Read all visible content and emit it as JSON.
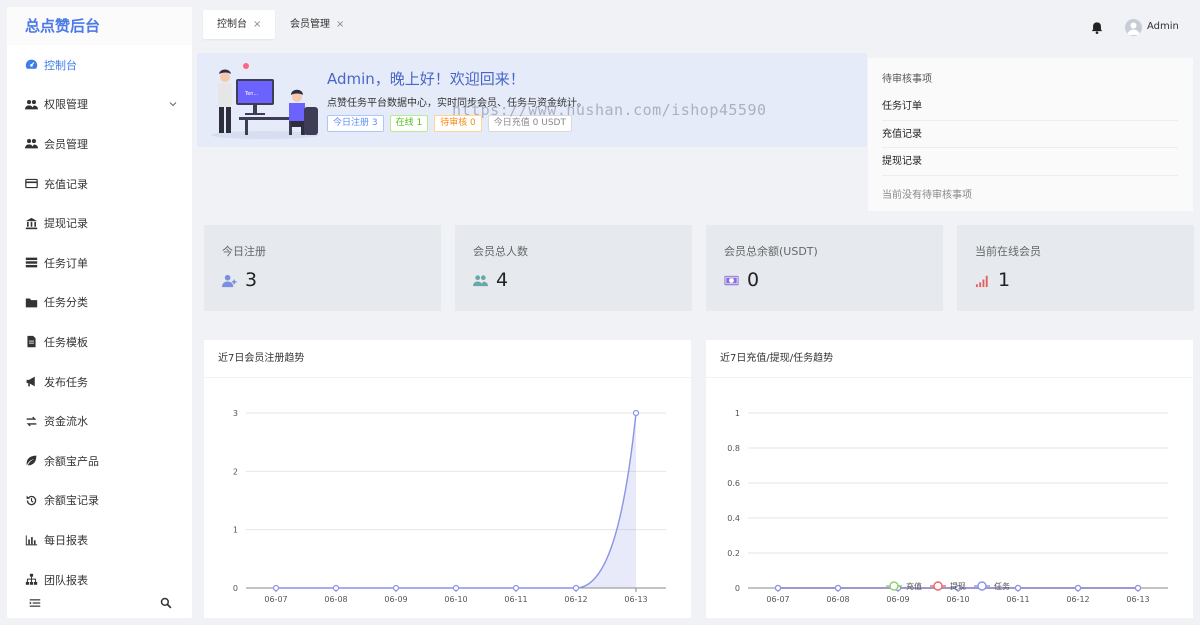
{
  "brand": "总点赞后台",
  "sidebar": {
    "items": [
      {
        "label": "控制台"
      },
      {
        "label": "权限管理"
      },
      {
        "label": "会员管理"
      },
      {
        "label": "充值记录"
      },
      {
        "label": "提现记录"
      },
      {
        "label": "任务订单"
      },
      {
        "label": "任务分类"
      },
      {
        "label": "任务模板"
      },
      {
        "label": "发布任务"
      },
      {
        "label": "资金流水"
      },
      {
        "label": "余额宝产品"
      },
      {
        "label": "余额宝记录"
      },
      {
        "label": "每日报表"
      },
      {
        "label": "团队报表"
      }
    ]
  },
  "tabs": [
    {
      "label": "控制台",
      "close": "×"
    },
    {
      "label": "会员管理",
      "close": "×"
    }
  ],
  "user": {
    "name": "Admin"
  },
  "welcome": {
    "greeting": "Admin，晚上好！欢迎回来！",
    "subtitle": "点赞任务平台数据中心，实时同步会员、任务与资金统计。",
    "badges": [
      {
        "text": "今日注册 3",
        "color": "#5b8ff9"
      },
      {
        "text": "在线 1",
        "color": "#52c41a"
      },
      {
        "text": "待审核 0",
        "color": "#fa8c16"
      },
      {
        "text": "今日充值 0 USDT",
        "color": "#888888"
      }
    ]
  },
  "watermark": "https://www.hushan.com/ishop45590",
  "pending": {
    "title": "待审核事项",
    "items": [
      "任务订单",
      "充值记录",
      "提现记录"
    ],
    "empty": "当前没有待审核事项"
  },
  "stats": [
    {
      "label": "今日注册",
      "value": "3",
      "icon": "user-plus-icon",
      "color": "#7a8fe0"
    },
    {
      "label": "会员总人数",
      "value": "4",
      "icon": "users-icon",
      "color": "#6aa7a8"
    },
    {
      "label": "会员总余额(USDT)",
      "value": "0",
      "icon": "money-icon",
      "color": "#8a6fd8"
    },
    {
      "label": "当前在线会员",
      "value": "1",
      "icon": "signal-icon",
      "color": "#e06060"
    }
  ],
  "chart_data": [
    {
      "type": "area",
      "title": "近7日会员注册趋势",
      "categories": [
        "06-07",
        "06-08",
        "06-09",
        "06-10",
        "06-11",
        "06-12",
        "06-13"
      ],
      "values": [
        0,
        0,
        0,
        0,
        0,
        0,
        3
      ],
      "ylim": [
        0,
        3
      ],
      "yticks": [
        0,
        1,
        2,
        3
      ],
      "color": "#8a94e6",
      "grid": true
    },
    {
      "type": "line",
      "title": "近7日充值/提现/任务趋势",
      "categories": [
        "06-07",
        "06-08",
        "06-09",
        "06-10",
        "06-11",
        "06-12",
        "06-13"
      ],
      "series": [
        {
          "name": "充值",
          "values": [
            0,
            0,
            0,
            0,
            0,
            0,
            0
          ],
          "color": "#91cc75"
        },
        {
          "name": "提现",
          "values": [
            0,
            0,
            0,
            0,
            0,
            0,
            0
          ],
          "color": "#ee6666"
        },
        {
          "name": "任务",
          "values": [
            0,
            0,
            0,
            0,
            0,
            0,
            0
          ],
          "color": "#8a94e6"
        }
      ],
      "ylim": [
        0,
        1
      ],
      "yticks": [
        "0",
        "0.2",
        "0.4",
        "0.6",
        "0.8",
        "1"
      ],
      "legend": "bottom-center",
      "grid": true
    }
  ]
}
